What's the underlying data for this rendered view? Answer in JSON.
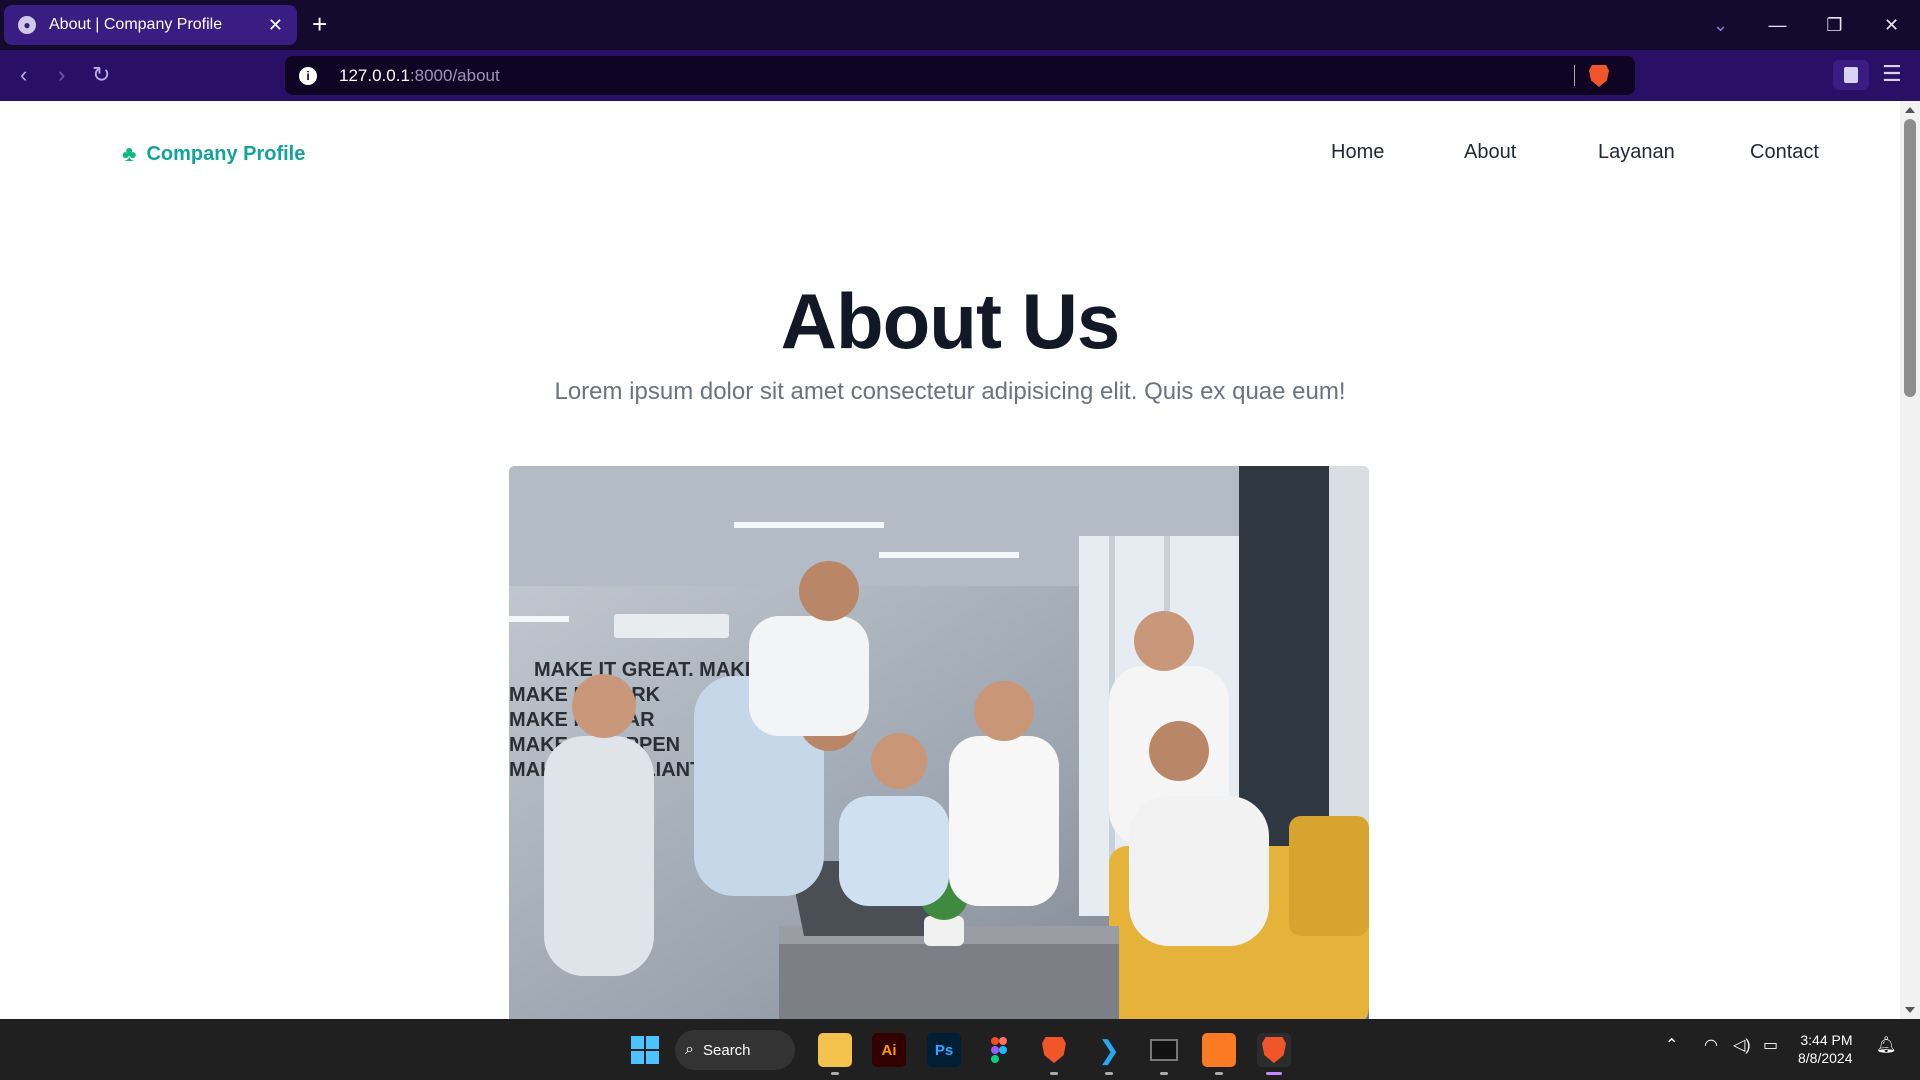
{
  "browser": {
    "tab_title": "About | Company Profile",
    "tab_close": "✕",
    "new_tab": "+",
    "url_host": "127.0.0.1",
    "url_path": ":8000/about",
    "window_controls": {
      "tabs_menu": "⌄",
      "minimize": "—",
      "restore": "❐",
      "close": "✕"
    },
    "nav": {
      "back": "‹",
      "forward": "›",
      "reload": "↻"
    },
    "menu_icon": "☰"
  },
  "site": {
    "brand": "Company Profile",
    "nav_items": [
      {
        "label": "Home"
      },
      {
        "label": "About"
      },
      {
        "label": "Layanan"
      },
      {
        "label": "Contact"
      }
    ],
    "heading_part1": "About",
    "heading_part2": "Us",
    "subtitle": "Lorem ipsum dolor sit amet consectetur adipisicing elit. Quis ex quae eum!",
    "wall_text": [
      "MAKE IT GREAT. MAKE",
      "MAKE IT WORK",
      "MAKE IT SOAR",
      "MAKE IT HAPPEN",
      "MAKE IT BRILLIANT"
    ],
    "accent_color": "#14a39a",
    "underline_color": "#7ee2c2"
  },
  "taskbar": {
    "search_label": "Search",
    "apps": [
      "File Explorer",
      "Illustrator",
      "Photoshop",
      "Figma",
      "Brave",
      "VS Code",
      "Terminal",
      "XAMPP",
      "Brave"
    ],
    "ai_label": "Ai",
    "ps_label": "Ps",
    "time": "3:44 PM",
    "date": "8/8/2024"
  }
}
